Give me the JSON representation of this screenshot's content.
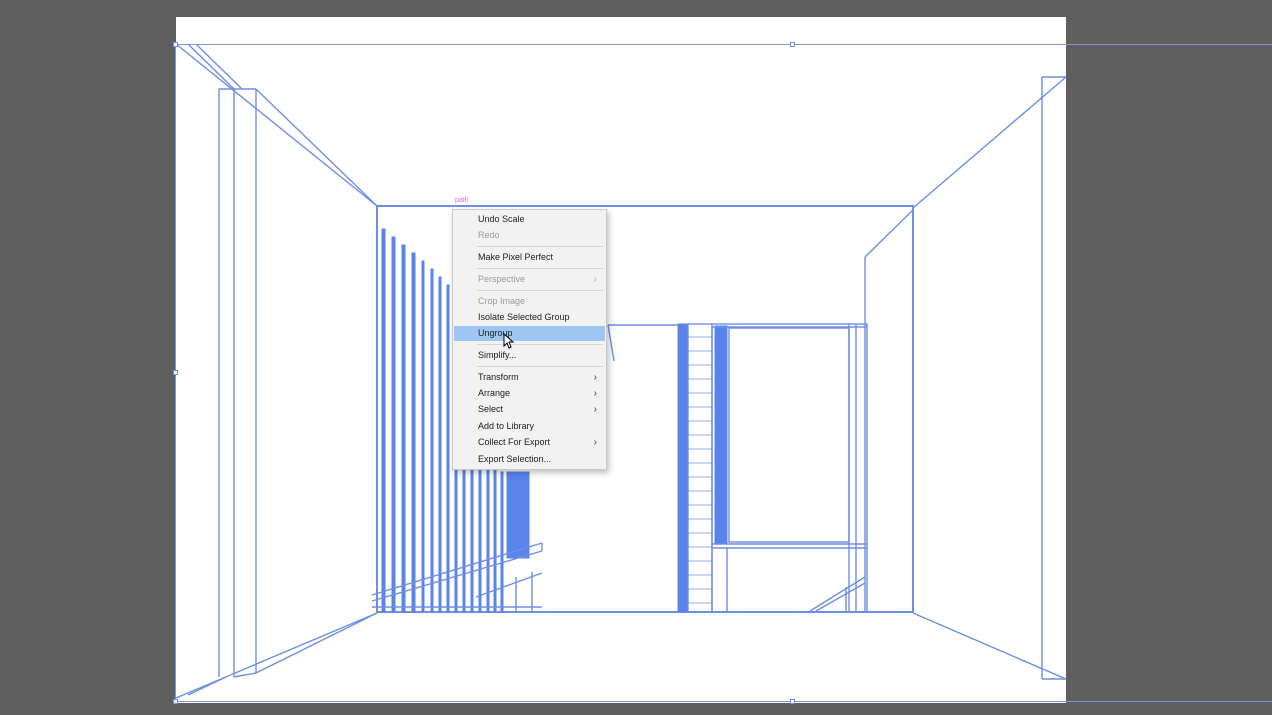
{
  "canvas": {
    "background": "#5f5f5f",
    "artboard_color": "#ffffff",
    "stroke_color": "#6e8fe0",
    "fill_color": "#5a84ec"
  },
  "selection": {
    "label": "path",
    "label_color": "#e26ac9"
  },
  "context_menu": {
    "items": [
      {
        "label": "Undo Scale",
        "enabled": true,
        "submenu": false
      },
      {
        "label": "Redo",
        "enabled": false,
        "submenu": false
      },
      {
        "label": "Make Pixel Perfect",
        "enabled": true,
        "submenu": false
      },
      {
        "label": "Perspective",
        "enabled": false,
        "submenu": true
      },
      {
        "label": "Crop Image",
        "enabled": false,
        "submenu": false
      },
      {
        "label": "Isolate Selected Group",
        "enabled": true,
        "submenu": false
      },
      {
        "label": "Ungroup",
        "enabled": true,
        "submenu": false,
        "highlighted": true
      },
      {
        "label": "Simplify...",
        "enabled": true,
        "submenu": false
      },
      {
        "label": "Transform",
        "enabled": true,
        "submenu": true
      },
      {
        "label": "Arrange",
        "enabled": true,
        "submenu": true
      },
      {
        "label": "Select",
        "enabled": true,
        "submenu": true
      },
      {
        "label": "Add to Library",
        "enabled": true,
        "submenu": false
      },
      {
        "label": "Collect For Export",
        "enabled": true,
        "submenu": true
      },
      {
        "label": "Export Selection...",
        "enabled": true,
        "submenu": false
      }
    ],
    "submenu_arrow": "›"
  },
  "cursor": {
    "icon": "arrow-pointer-icon"
  }
}
